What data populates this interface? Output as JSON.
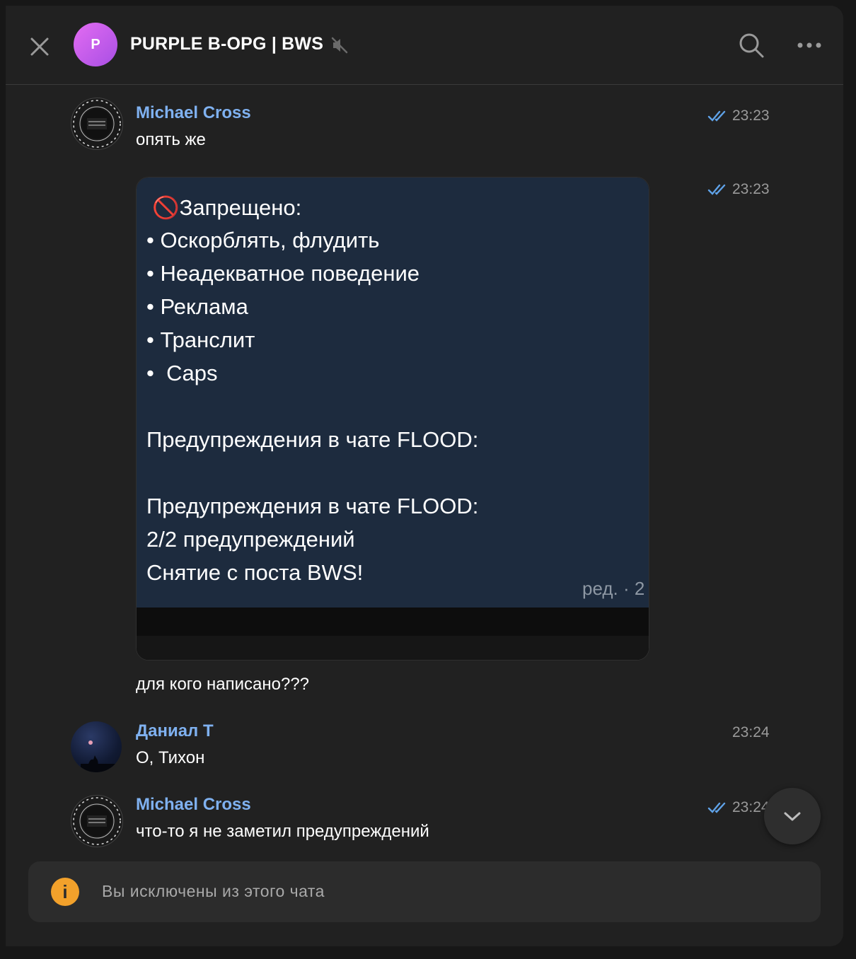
{
  "header": {
    "avatar_letter": "P",
    "title": "PURPLE B-OPG | BWS",
    "icons": [
      "close-icon",
      "muted-icon",
      "search-icon",
      "more-icon"
    ]
  },
  "messages": [
    {
      "sender": "Michael Cross",
      "text": "опять же",
      "time": "23:23",
      "read": true,
      "avatar": "clock-avatar"
    },
    {
      "type": "media",
      "time": "23:23",
      "read": true,
      "screenshot_lines": [
        "🚫Запрещено:",
        "• Оскорблять, флудить",
        "• Неадекватное поведение",
        "• Реклама",
        "• Транслит",
        "•  Caps",
        "Предупреждения в чате FLOOD:",
        "Предупреждения в чате FLOOD:",
        "2/2 предупреждений",
        "Снятие с поста BWS!"
      ],
      "screenshot_edited": "ред. · 2"
    },
    {
      "text": "для кого написано???"
    },
    {
      "sender": "Даниал Т",
      "text": "О, Тихон",
      "time": "23:24",
      "avatar": "night-avatar"
    },
    {
      "sender": "Michael Cross",
      "text": "что-то я не заметил предупреждений",
      "time": "23:24",
      "read": true,
      "avatar": "clock-avatar"
    }
  ],
  "notice": {
    "icon": "info-icon",
    "icon_glyph": "i",
    "text": "Вы исключены из этого чата"
  },
  "colors": {
    "accent_name": "#7fb1f0",
    "background": "#212121",
    "notice_icon": "#f2a12b",
    "screenshot_bg": "#1d2b3e"
  }
}
